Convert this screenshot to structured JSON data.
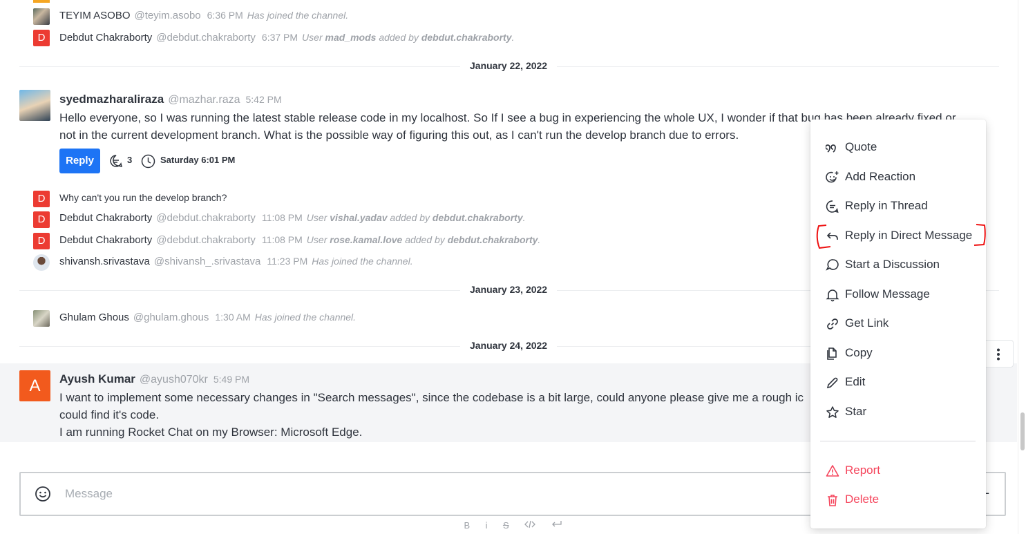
{
  "system_messages": [
    {
      "name": "TEYIM ASOBO",
      "username": "@teyim.asobo",
      "time": "6:36 PM",
      "text": "Has joined the channel."
    },
    {
      "name": "Debdut Chakraborty",
      "username": "@debdut.chakraborty",
      "time": "6:37 PM",
      "prefix": "User",
      "target": "mad_mods",
      "mid": "added by",
      "actor": "debdut.chakraborty",
      "suffix": "."
    }
  ],
  "dates": {
    "d1": "January 22, 2022",
    "d2": "January 23, 2022",
    "d3": "January 24, 2022"
  },
  "message1": {
    "name": "syedmazharaliraza",
    "username": "@mazhar.raza",
    "time": "5:42 PM",
    "line1": "Hello everyone, so I was running the latest stable release code in my localhost. So If I see a bug in experiencing the whole UX, I wonder if that bug has been already fixed or",
    "line2": "not in the current development branch. What is the possible way of figuring this out, as I can't run the develop branch due to errors.",
    "reply_label": "Reply",
    "reply_count": "3",
    "last_reply": "Saturday 6:01 PM"
  },
  "thread_lines": [
    {
      "text": "Why can't you run the develop branch?"
    },
    {
      "name": "Debdut Chakraborty",
      "username": "@debdut.chakraborty",
      "time": "11:08 PM",
      "prefix": "User",
      "target": "vishal.yadav",
      "mid": "added by",
      "actor": "debdut.chakraborty",
      "suffix": "."
    },
    {
      "name": "Debdut Chakraborty",
      "username": "@debdut.chakraborty",
      "time": "11:08 PM",
      "prefix": "User",
      "target": "rose.kamal.love",
      "mid": "added by",
      "actor": "debdut.chakraborty",
      "suffix": "."
    },
    {
      "name": "shivansh.srivastava",
      "username": "@shivansh_.srivastava",
      "time": "11:23 PM",
      "text": "Has joined the channel."
    }
  ],
  "jan23": {
    "name": "Ghulam Ghous",
    "username": "@ghulam.ghous",
    "time": "1:30 AM",
    "text": "Has joined the channel."
  },
  "message2": {
    "avatar_letter": "A",
    "name": "Ayush Kumar",
    "username": "@ayush070kr",
    "time": "5:49 PM",
    "line1": "I want to implement some necessary changes in \"Search messages\", since the codebase is a bit large, could anyone please give me a rough ic",
    "line2": "could find it's code.",
    "line3": "I am running Rocket Chat on my Browser: Microsoft Edge."
  },
  "avatar_letter_d": "D",
  "composer": {
    "placeholder": "Message"
  },
  "format_bar": {
    "bold": "B",
    "italic": "i",
    "strike": "S"
  },
  "menu": {
    "items": [
      {
        "label": "Quote",
        "icon": "quote-icon"
      },
      {
        "label": "Add Reaction",
        "icon": "add-reaction-icon"
      },
      {
        "label": "Reply in Thread",
        "icon": "thread-icon"
      },
      {
        "label": "Reply in Direct Message",
        "icon": "reply-arrow-icon"
      },
      {
        "label": "Start a Discussion",
        "icon": "discussion-icon"
      },
      {
        "label": "Follow Message",
        "icon": "bell-icon"
      },
      {
        "label": "Get Link",
        "icon": "link-icon"
      },
      {
        "label": "Copy",
        "icon": "copy-icon"
      },
      {
        "label": "Edit",
        "icon": "pencil-icon"
      },
      {
        "label": "Star",
        "icon": "star-icon"
      }
    ],
    "danger_items": [
      {
        "label": "Report",
        "icon": "warning-icon"
      },
      {
        "label": "Delete",
        "icon": "trash-icon"
      }
    ]
  },
  "colors": {
    "accent": "#1d74f5",
    "danger": "#f5455c",
    "avatar_d": "#ec3b32",
    "avatar_a": "#f25a1d"
  }
}
